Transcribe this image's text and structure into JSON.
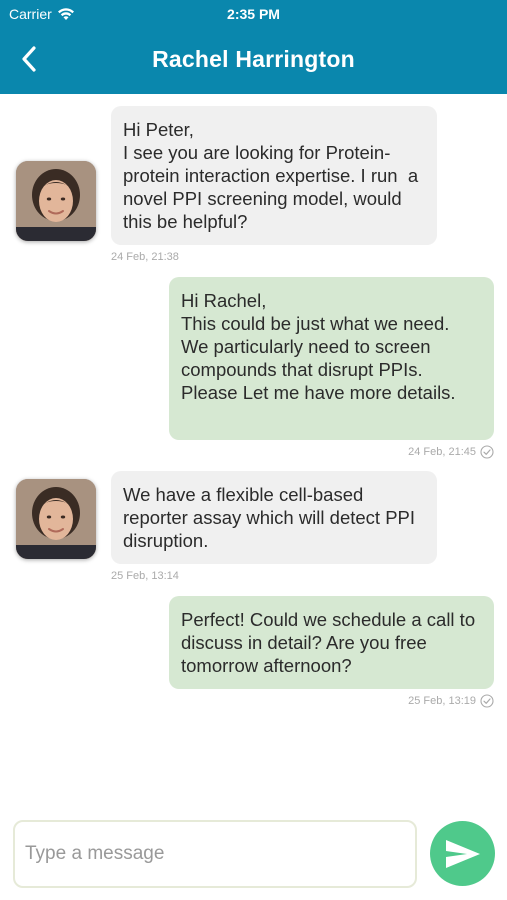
{
  "status_bar": {
    "carrier": "Carrier",
    "time": "2:35 PM"
  },
  "header": {
    "title": "Rachel Harrington",
    "back_icon": "chevron-left-icon"
  },
  "messages": [
    {
      "direction": "incoming",
      "text": "Hi Peter,\nI see you are looking for Protein-protein interaction expertise. I run  a novel PPI screening model, would this be helpful?",
      "timestamp": "24 Feb, 21:38"
    },
    {
      "direction": "outgoing",
      "text": "Hi Rachel,\nThis could be just what we need.  We particularly need to screen compounds that disrupt PPIs. Please Let me have more details.",
      "timestamp": "24 Feb, 21:45"
    },
    {
      "direction": "incoming",
      "text": "We have a flexible cell-based reporter assay which will detect PPI disruption.",
      "timestamp": "25 Feb, 13:14"
    },
    {
      "direction": "outgoing",
      "text": "Perfect! Could we schedule a call to discuss in detail? Are you free tomorrow afternoon?",
      "timestamp": "25 Feb, 13:19"
    }
  ],
  "composer": {
    "placeholder": "Type a message",
    "value": "",
    "send_icon": "send-icon"
  },
  "colors": {
    "header": "#0a87ad",
    "incoming_bubble": "#f0f0f0",
    "outgoing_bubble": "#d6e8d2",
    "send_button": "#4fc98b"
  }
}
